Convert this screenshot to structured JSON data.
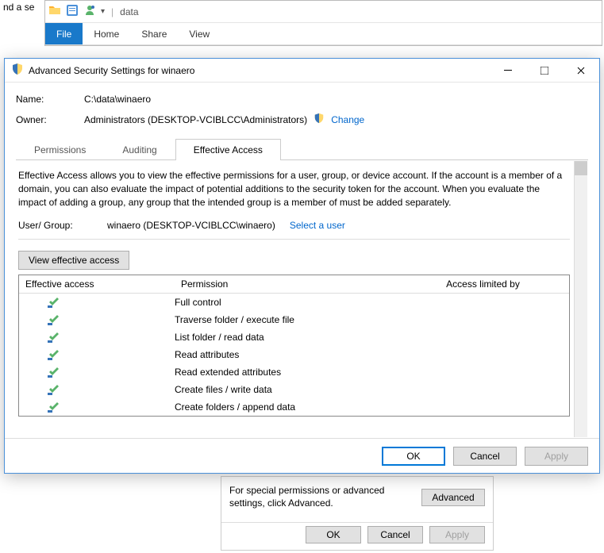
{
  "explorer": {
    "title_prefix": "|",
    "title_text": "data",
    "ribbon": {
      "file": "File",
      "home": "Home",
      "share": "Share",
      "view": "View"
    }
  },
  "find_fragment": "nd a se",
  "dialog": {
    "title": "Advanced Security Settings for winaero",
    "name_label": "Name:",
    "name_value": "C:\\data\\winaero",
    "owner_label": "Owner:",
    "owner_value": "Administrators (DESKTOP-VCIBLCC\\Administrators)",
    "change_link": "Change",
    "tabs": {
      "permissions": "Permissions",
      "auditing": "Auditing",
      "effective": "Effective Access"
    },
    "effective_desc": "Effective Access allows you to view the effective permissions for a user, group, or device account. If the account is a member of a domain, you can also evaluate the impact of potential additions to the security token for the account. When you evaluate the impact of adding a group, any group that the intended group is a member of must be added separately.",
    "user_group_label": "User/ Group:",
    "user_group_value": "winaero (DESKTOP-VCIBLCC\\winaero)",
    "select_user_link": "Select a user",
    "view_button": "View effective access",
    "grid": {
      "col_effective": "Effective access",
      "col_permission": "Permission",
      "col_limited": "Access limited by",
      "rows": [
        "Full control",
        "Traverse folder / execute file",
        "List folder / read data",
        "Read attributes",
        "Read extended attributes",
        "Create files / write data",
        "Create folders / append data"
      ]
    },
    "buttons": {
      "ok": "OK",
      "cancel": "Cancel",
      "apply": "Apply"
    }
  },
  "prop_strip": {
    "adv_text": "For special permissions or advanced settings, click Advanced.",
    "advanced": "Advanced",
    "ok": "OK",
    "cancel": "Cancel",
    "apply": "Apply"
  }
}
